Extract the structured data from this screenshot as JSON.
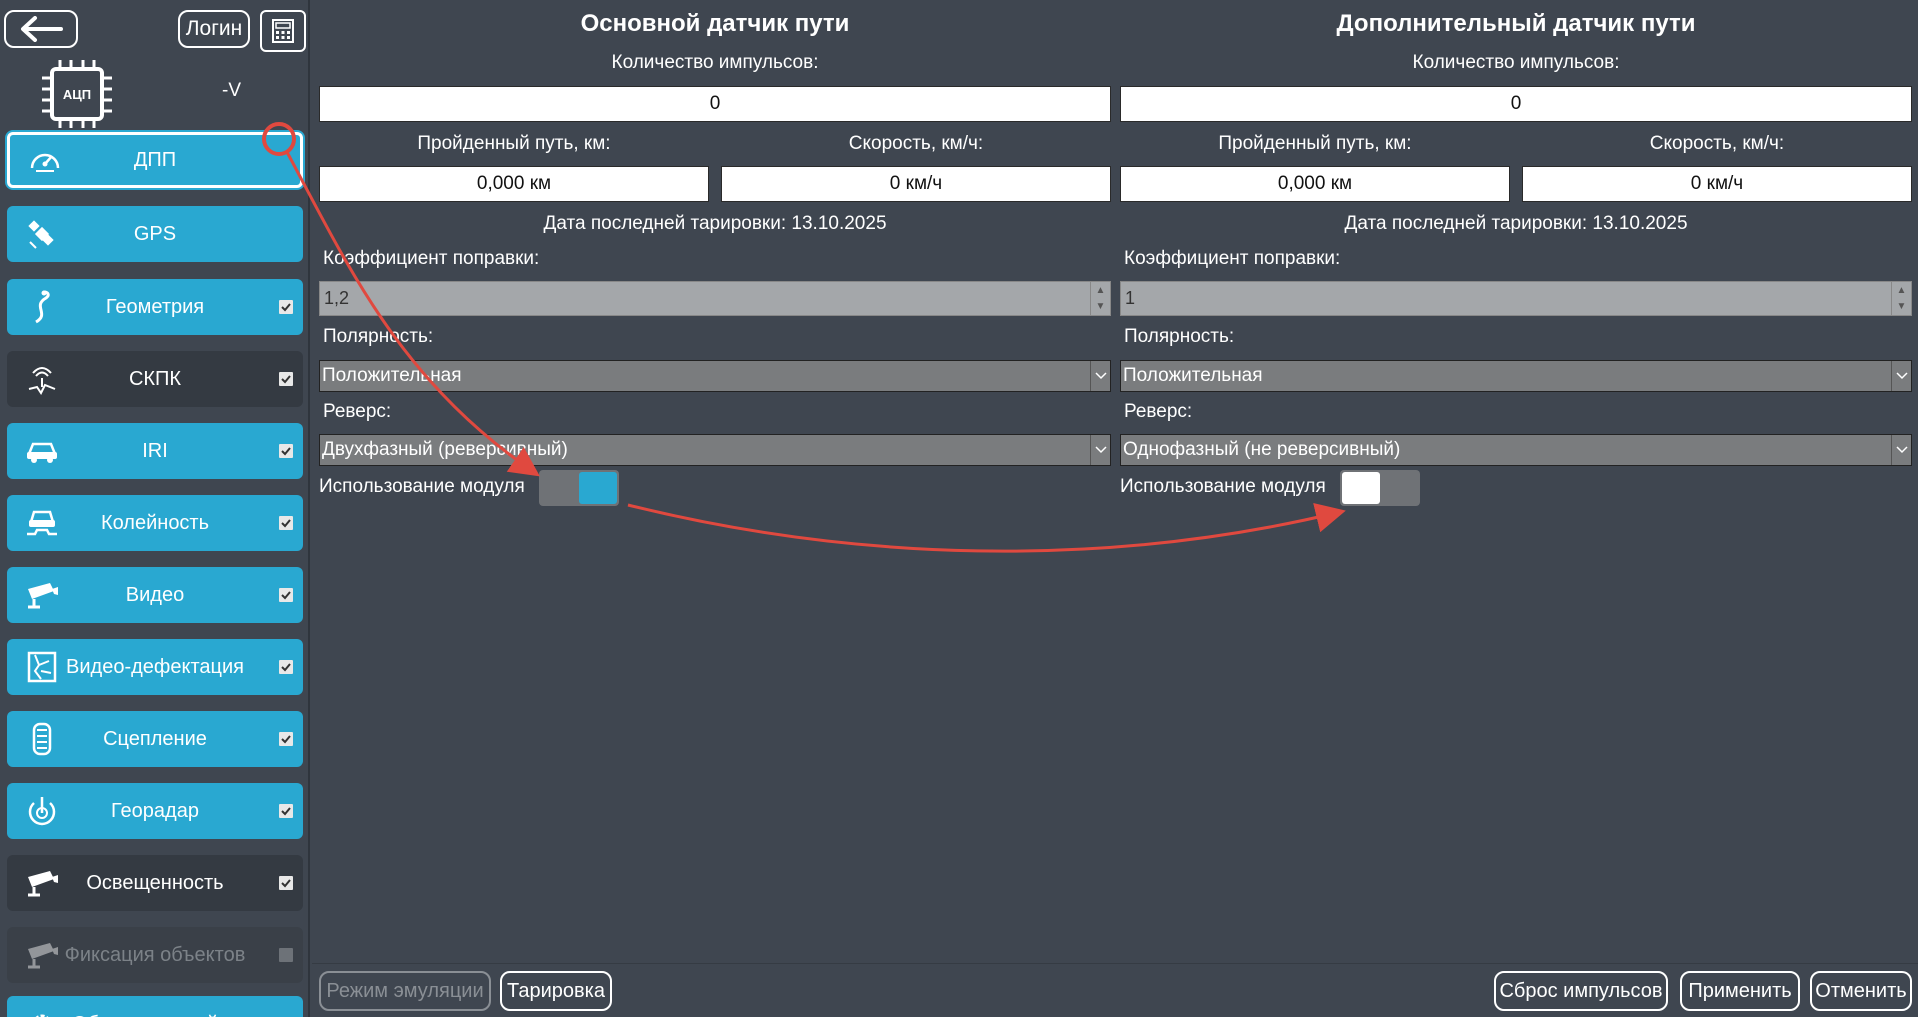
{
  "header": {
    "login_label": "Логин",
    "chip_label": "АЦП",
    "voltage": "-V"
  },
  "sidebar": {
    "items": [
      {
        "label": "ДПП",
        "icon": "speedometer-icon",
        "checkbox": false
      },
      {
        "label": "GPS",
        "icon": "satellite-icon",
        "checkbox": false
      },
      {
        "label": "Геометрия",
        "icon": "road-curve-icon",
        "checkbox": true
      },
      {
        "label": "СКПК",
        "icon": "sensor-icon",
        "checkbox": true
      },
      {
        "label": "IRI",
        "icon": "car-icon",
        "checkbox": true
      },
      {
        "label": "Колейность",
        "icon": "car-rut-icon",
        "checkbox": true
      },
      {
        "label": "Видео",
        "icon": "camera-icon",
        "checkbox": true
      },
      {
        "label": "Видео-дефектация",
        "icon": "crack-icon",
        "checkbox": true
      },
      {
        "label": "Сцепление",
        "icon": "tire-icon",
        "checkbox": true
      },
      {
        "label": "Георадар",
        "icon": "radar-icon",
        "checkbox": true
      },
      {
        "label": "Освещенность",
        "icon": "camera-icon",
        "checkbox": true
      },
      {
        "label": "Фиксация объектов",
        "icon": "camera-icon",
        "checkbox": false
      },
      {
        "label": "Общие настройки",
        "icon": "gear-icon"
      }
    ]
  },
  "primary": {
    "title": "Основной датчик пути",
    "pulse_label": "Количество импульсов:",
    "pulse_value": "0",
    "distance_label": "Пройденный путь, км:",
    "distance_value": "0,000 км",
    "speed_label": "Скорость, км/ч:",
    "speed_value": "0 км/ч",
    "calibration": "Дата последней тарировки: 13.10.2025",
    "coef_label": "Коэффициент поправки:",
    "coef_value": "1,2",
    "polarity_label": "Полярность:",
    "polarity_value": "Положительная",
    "reverse_label": "Реверс:",
    "reverse_value": "Двухфазный (реверсивный)",
    "module_label": "Использование модуля",
    "module_on": true
  },
  "secondary": {
    "title": "Дополнительный датчик пути",
    "pulse_label": "Количество импульсов:",
    "pulse_value": "0",
    "distance_label": "Пройденный путь, км:",
    "distance_value": "0,000 км",
    "speed_label": "Скорость, км/ч:",
    "speed_value": "0 км/ч",
    "calibration": "Дата последней тарировки: 13.10.2025",
    "coef_label": "Коэффициент поправки:",
    "coef_value": "1",
    "polarity_label": "Полярность:",
    "polarity_value": "Положительная",
    "reverse_label": "Реверс:",
    "reverse_value": "Однофазный (не реверсивный)",
    "module_label": "Использование модуля",
    "module_on": false
  },
  "footer": {
    "emulation": "Режим эмуляции",
    "calibrate": "Тарировка",
    "reset": "Сброс импульсов",
    "apply": "Применить",
    "cancel": "Отменить"
  },
  "colors": {
    "accent": "#29a8d1",
    "background": "#3f4650",
    "annotation": "#e0493f"
  }
}
